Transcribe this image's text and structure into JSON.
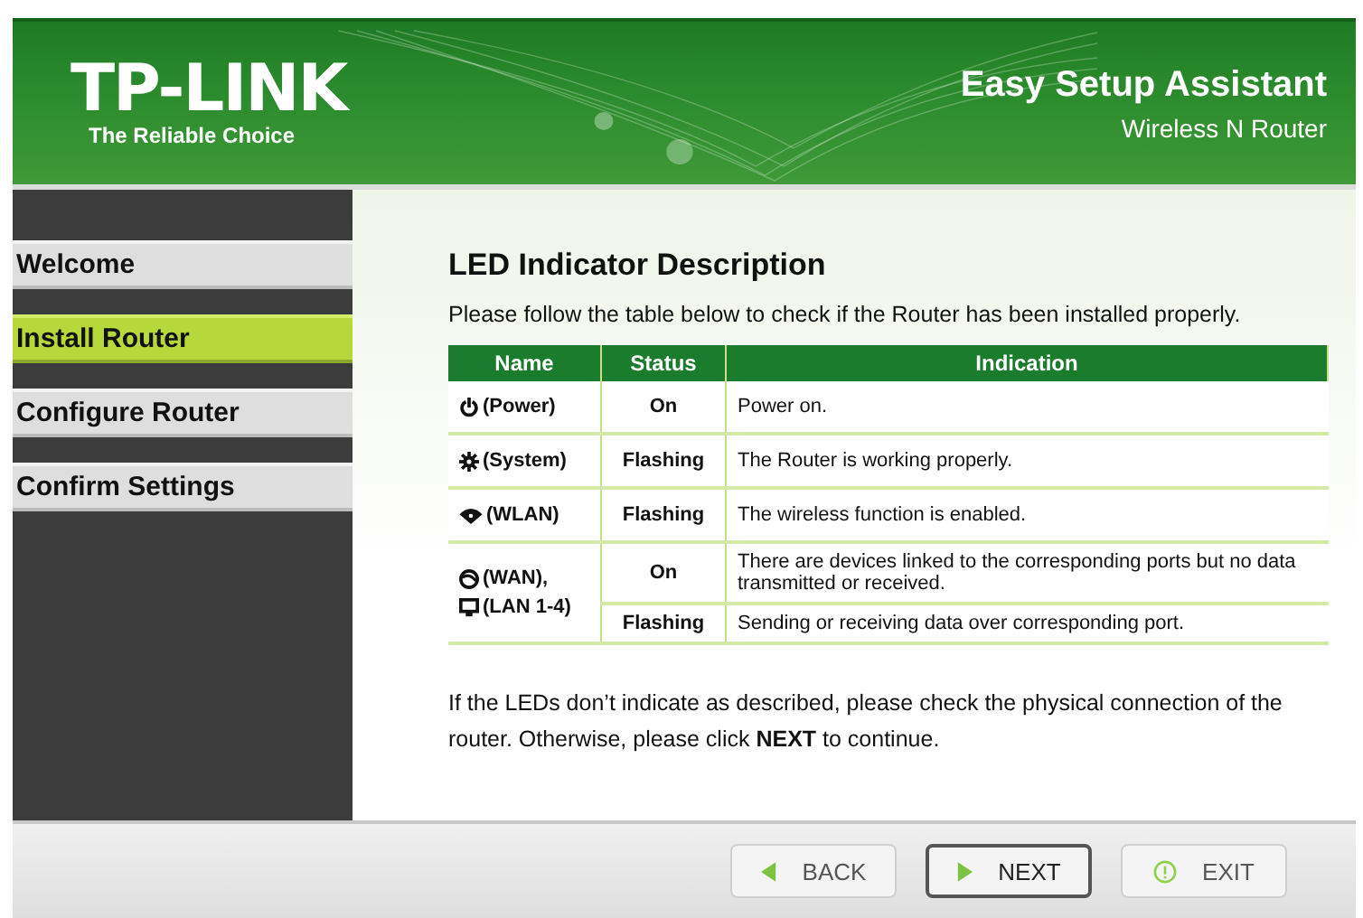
{
  "header": {
    "logo": "TP-LINK",
    "tagline": "The Reliable Choice",
    "title": "Easy Setup Assistant",
    "subtitle": "Wireless N Router"
  },
  "sidebar": {
    "items": [
      {
        "label": "Welcome",
        "selected": false
      },
      {
        "label": "Install Router",
        "selected": true
      },
      {
        "label": "Configure Router",
        "selected": false
      },
      {
        "label": "Confirm Settings",
        "selected": false
      }
    ]
  },
  "content": {
    "heading": "LED Indicator Description",
    "intro": "Please follow the table below to check if the Router has been installed properly.",
    "table": {
      "columns": [
        "Name",
        "Status",
        "Indication"
      ],
      "rows": [
        {
          "names": [
            {
              "kind": "power",
              "label": "(Power)"
            }
          ],
          "states": [
            {
              "status": "On",
              "indication": "Power on."
            }
          ]
        },
        {
          "names": [
            {
              "kind": "system",
              "label": "(System)"
            }
          ],
          "states": [
            {
              "status": "Flashing",
              "indication": "The Router is working properly."
            }
          ]
        },
        {
          "names": [
            {
              "kind": "wlan",
              "label": "(WLAN)"
            }
          ],
          "states": [
            {
              "status": "Flashing",
              "indication": "The wireless function is enabled."
            }
          ]
        },
        {
          "names": [
            {
              "kind": "wan",
              "label": "(WAN),"
            },
            {
              "kind": "lan",
              "label": "(LAN 1-4)"
            }
          ],
          "states": [
            {
              "status": "On",
              "indication": "There are devices linked to the corresponding ports but no data transmitted or received."
            },
            {
              "status": "Flashing",
              "indication": "Sending or receiving data over corresponding port."
            }
          ]
        }
      ]
    },
    "note": "If the LEDs don’t indicate as described, please check the physical connection of the router. Otherwise, please click **NEXT** to continue."
  },
  "buttons": [
    {
      "label": "BACK",
      "kind": "back",
      "default": false
    },
    {
      "label": "NEXT",
      "kind": "next",
      "default": true
    },
    {
      "label": "EXIT",
      "kind": "exit",
      "default": false
    }
  ]
}
